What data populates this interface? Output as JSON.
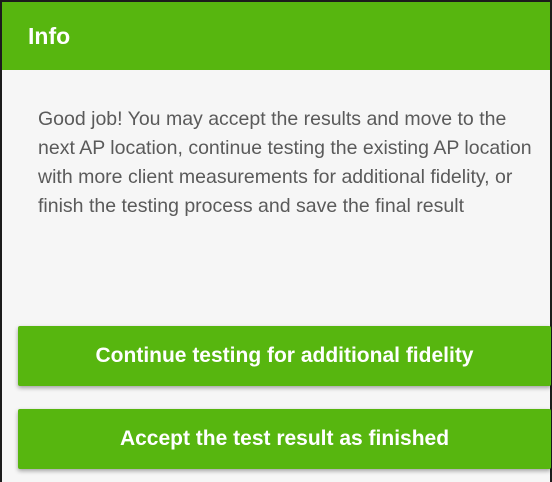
{
  "dialog": {
    "title": "Info",
    "message": "Good job!  You may accept the results and move to the next AP location, continue testing the existing AP location with more client measurements for additional fidelity, or finish the testing process and save the final result",
    "buttons": {
      "continue_label": "Continue testing for additional fidelity",
      "accept_label": "Accept the test result as finished"
    }
  },
  "colors": {
    "accent": "#57b60f",
    "button_text": "#ffffff",
    "body_text": "#5a5a5a",
    "background": "#f6f6f6"
  }
}
